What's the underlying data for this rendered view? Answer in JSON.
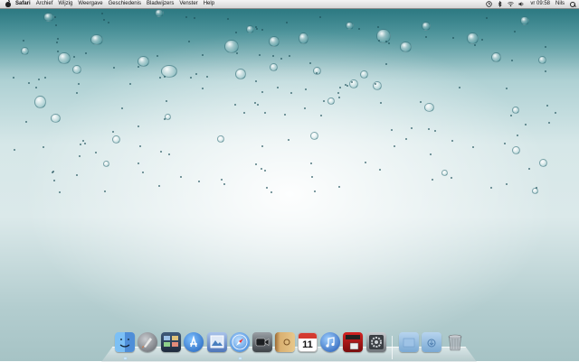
{
  "menubar": {
    "apple_icon": "apple-icon",
    "app_name": "Safari",
    "menus": [
      "Archief",
      "Wijzig",
      "Weergave",
      "Geschiedenis",
      "Bladwijzers",
      "Venster",
      "Help"
    ],
    "status_icons": [
      "timemachine-icon",
      "bluetooth-icon",
      "wifi-icon",
      "volume-icon"
    ],
    "clock": "vr 09:58",
    "user": "Nils",
    "spotlight_icon": "spotlight-icon"
  },
  "dock": {
    "apps": [
      {
        "name": "finder",
        "icon": "finder-icon",
        "color": "#5aa0e8"
      },
      {
        "name": "launchpad",
        "icon": "launchpad-icon",
        "color": "#7a7f86"
      },
      {
        "name": "mission-control",
        "icon": "mission-control-icon",
        "color": "#3b4a63"
      },
      {
        "name": "app-store",
        "icon": "app-store-icon",
        "color": "#2f7fd6"
      },
      {
        "name": "preview",
        "icon": "preview-icon",
        "color": "#6b8fc9"
      },
      {
        "name": "safari",
        "icon": "safari-icon",
        "color": "#3c8fe0"
      },
      {
        "name": "facetime",
        "icon": "facetime-icon",
        "color": "#555a60"
      },
      {
        "name": "address-book",
        "icon": "address-book-icon",
        "color": "#c79a55"
      },
      {
        "name": "ical",
        "icon": "calendar-icon",
        "color": "#ffffff",
        "text": "11"
      },
      {
        "name": "itunes",
        "icon": "itunes-icon",
        "color": "#2e6fd0"
      },
      {
        "name": "photo-booth",
        "icon": "photo-booth-icon",
        "color": "#b01d1d"
      },
      {
        "name": "system-preferences",
        "icon": "system-preferences-icon",
        "color": "#8d9196"
      }
    ],
    "stacks": [
      {
        "name": "applications-folder",
        "icon": "folder-icon",
        "color": "#8fb9dd"
      },
      {
        "name": "downloads-folder",
        "icon": "downloads-folder-icon",
        "color": "#8fb9dd"
      },
      {
        "name": "trash",
        "icon": "trash-icon",
        "color": "#9aa0a6"
      }
    ]
  }
}
